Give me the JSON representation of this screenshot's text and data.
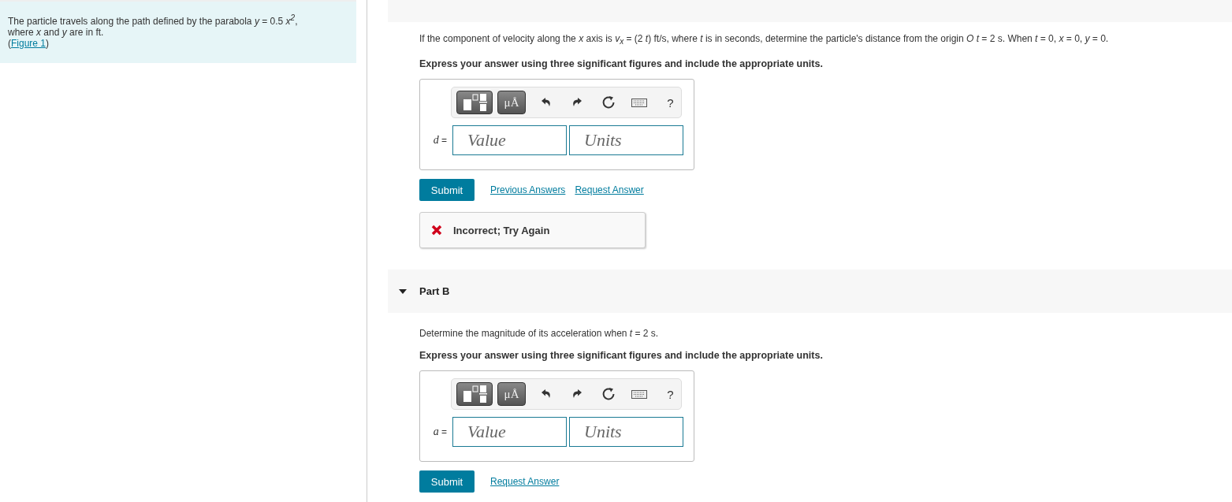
{
  "intro": {
    "text": "The particle travels along the path defined by the parabola *y* = 0.5 *x$^{2}$*,\nwhere *x* and *y* are in ft.",
    "link_open": "(",
    "link": "Figure 1",
    "link_close": ")"
  },
  "parts": [
    {
      "kind": "cut",
      "question": "If the component of velocity along the *x* axis is *v$_{x}$* = (2 *t*) ft/s, where *t* is in seconds, determine the particle's distance from the origin *O* *t* = 2 s. When *t* = 0, *x* = 0, *y* = 0.",
      "instruction": "Express your answer using three significant figures and include the appropriate units.",
      "toolbar": {
        "units_label": "μÅ",
        "help_label": "?"
      },
      "variable": "d",
      "equals": "=",
      "value_placeholder": "Value",
      "units_placeholder": "Units",
      "submit": "Submit",
      "links": [
        "Previous Answers",
        "Request Answer"
      ],
      "feedback": {
        "kind": "incorrect",
        "text": "Incorrect; Try Again"
      }
    },
    {
      "kind": "titled",
      "title": "Part B",
      "expanded": true,
      "question": "Determine the magnitude of its acceleration when *t* = 2 s.",
      "instruction": "Express your answer using three significant figures and include the appropriate units.",
      "toolbar": {
        "units_label": "μÅ",
        "help_label": "?"
      },
      "variable": "a",
      "equals": "=",
      "value_placeholder": "Value",
      "units_placeholder": "Units",
      "submit": "Submit",
      "links": [
        "Request Answer"
      ]
    }
  ]
}
